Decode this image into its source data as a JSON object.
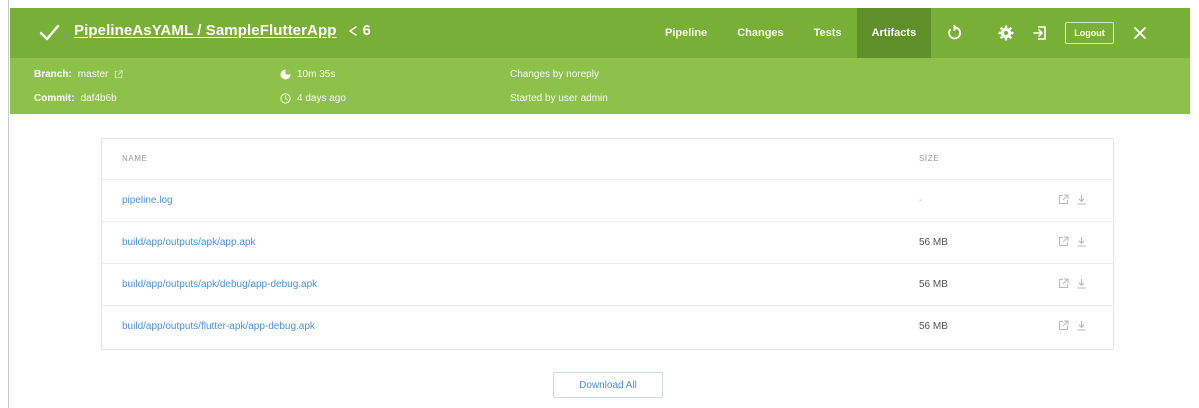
{
  "header": {
    "title_link": "PipelineAsYAML / SampleFlutterApp",
    "run_number": "6",
    "nav": [
      {
        "label": "Pipeline",
        "active": false
      },
      {
        "label": "Changes",
        "active": false
      },
      {
        "label": "Tests",
        "active": false
      },
      {
        "label": "Artifacts",
        "active": true
      }
    ],
    "logout_label": "Logout",
    "icons": [
      "check-icon",
      "run-icon",
      "replay-icon",
      "gear-icon",
      "exit-icon",
      "close-icon"
    ],
    "colors": {
      "topbar": "#78b037",
      "metabar": "#8ec14a",
      "active_tab": "#5f8f29",
      "link": "#4a90d9"
    }
  },
  "meta": {
    "branch_label": "Branch:",
    "branch_value": "master",
    "commit_label": "Commit:",
    "commit_value": "daf4b6b",
    "duration": "10m 35s",
    "age": "4 days ago",
    "changes": "Changes by noreply",
    "started": "Started by user admin"
  },
  "table": {
    "col_name": "NAME",
    "col_size": "SIZE",
    "rows": [
      {
        "name": "pipeline.log",
        "size": "-"
      },
      {
        "name": "build/app/outputs/apk/app.apk",
        "size": "56 MB"
      },
      {
        "name": "build/app/outputs/apk/debug/app-debug.apk",
        "size": "56 MB"
      },
      {
        "name": "build/app/outputs/flutter-apk/app-debug.apk",
        "size": "56 MB"
      }
    ]
  },
  "download_all_label": "Download All"
}
